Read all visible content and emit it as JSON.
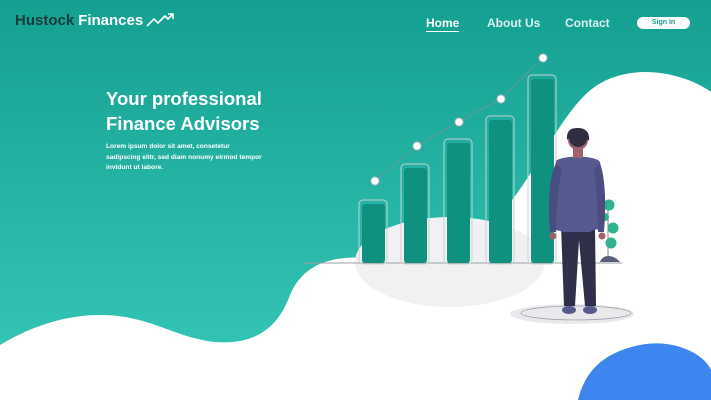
{
  "brand": {
    "name_dark": "Hustock",
    "name_light": "Finances",
    "logo_icon": "trend-line-icon"
  },
  "nav": {
    "items": [
      {
        "label": "Home",
        "active": true
      },
      {
        "label": "About Us",
        "active": false
      },
      {
        "label": "Contact",
        "active": false
      }
    ],
    "signin_label": "Sign In"
  },
  "hero": {
    "title_line1": "Your professional",
    "title_line2": "Finance Advisors",
    "body": "Lorem ipsum dolor sit amet, consetetur sadipscing elitr, sed diam nonumy eirmod tempor invidunt ut labore."
  },
  "illustration": {
    "type": "growth-bar-chart-with-person",
    "bar_count": 5,
    "relative_heights": [
      0.31,
      0.51,
      0.64,
      0.78,
      1.0
    ]
  },
  "colors": {
    "teal_top": "#14a091",
    "teal_bottom": "#33c3b4",
    "bar": "#10917f",
    "blue_blob": "#3d86f0",
    "suit": "#575a8f",
    "text_dark": "#1d3b3a"
  }
}
